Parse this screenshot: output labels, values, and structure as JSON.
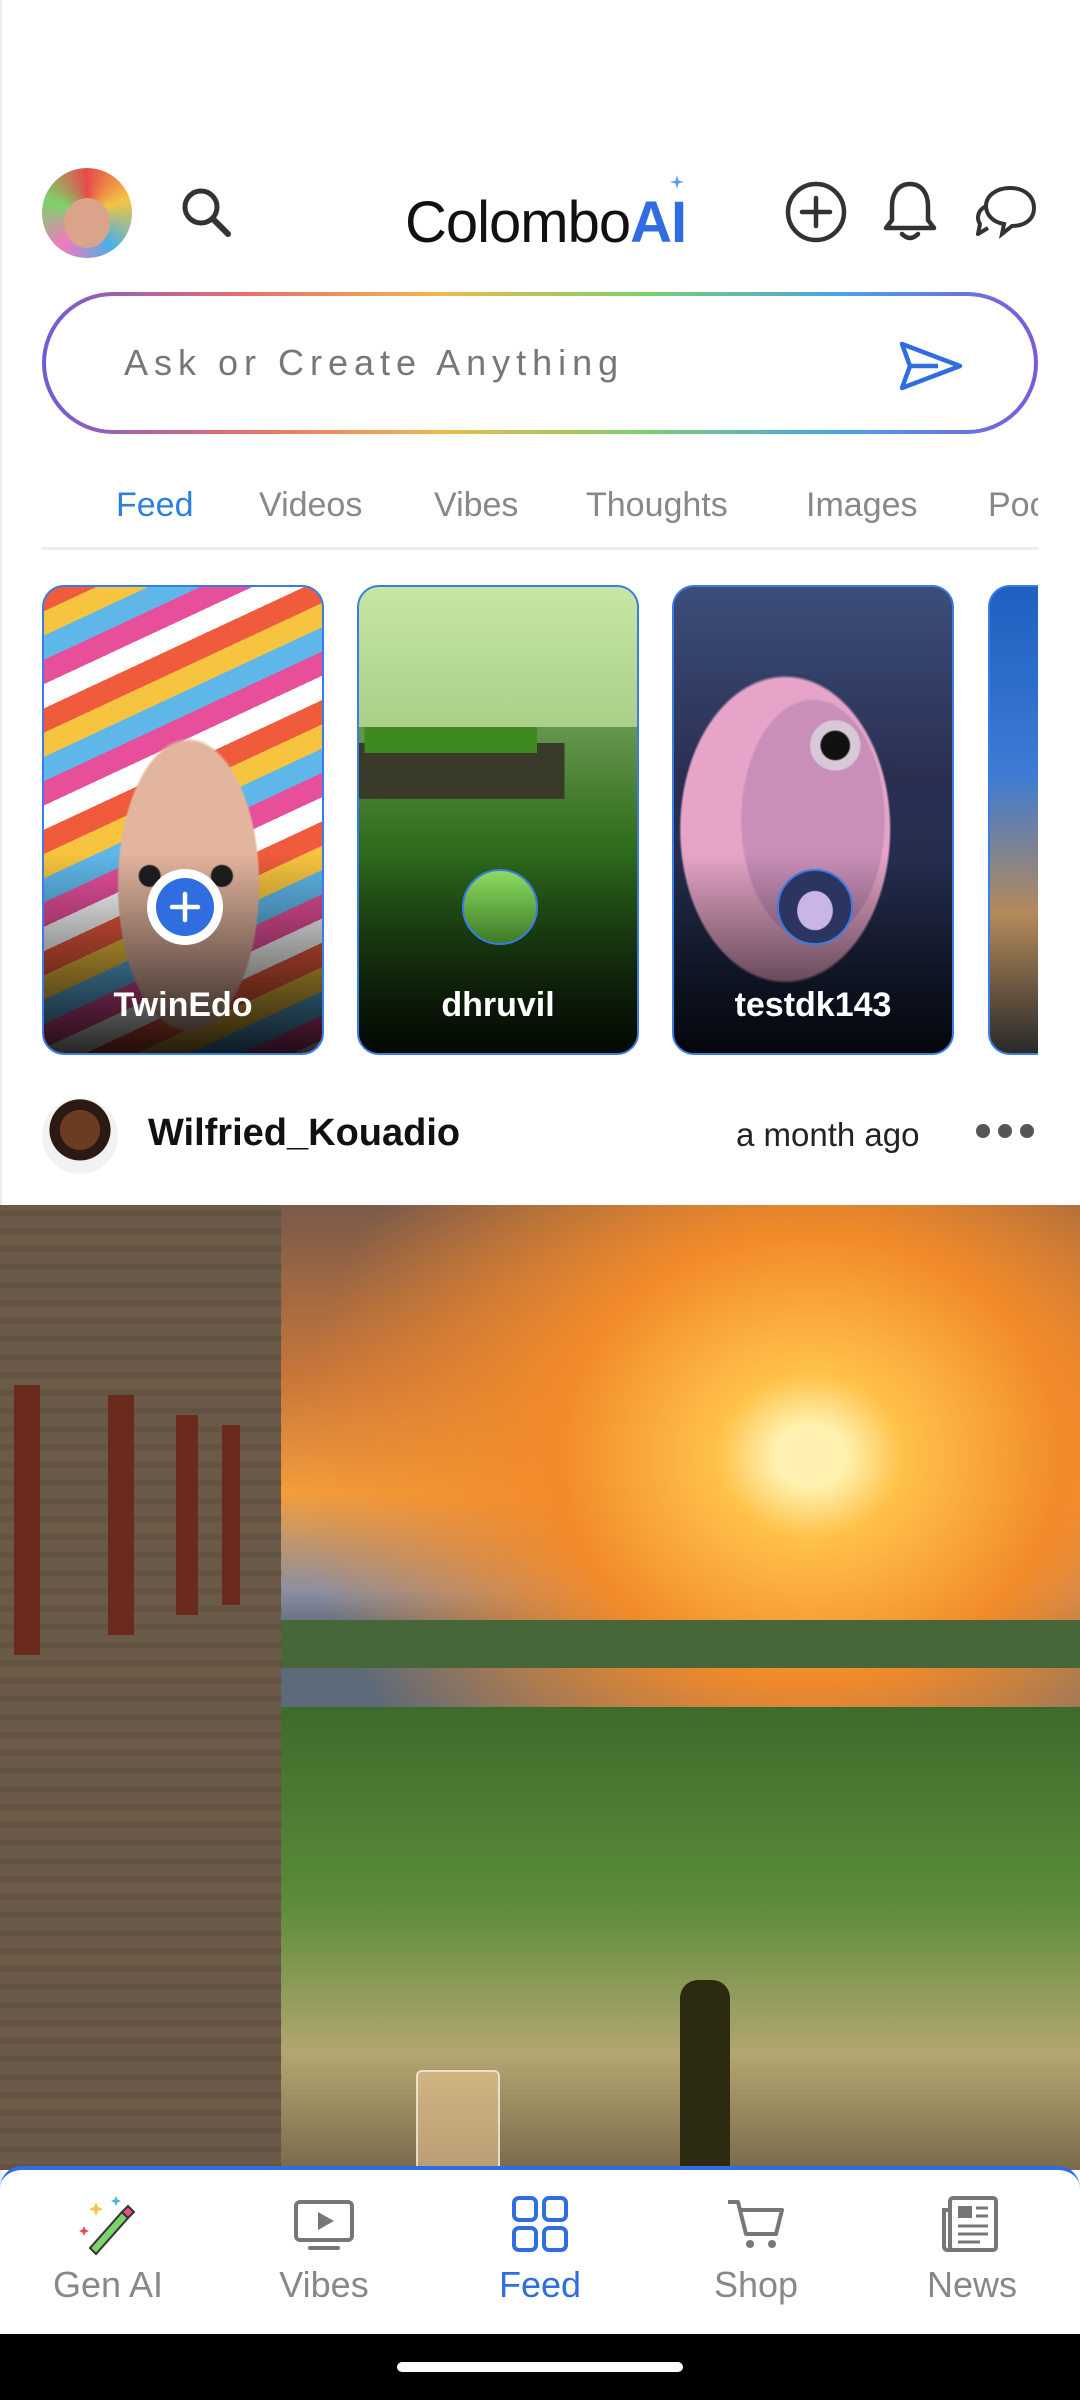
{
  "header": {
    "logo_text": "Colombo",
    "logo_accent": "AI",
    "brand_color": "#2f6de1"
  },
  "search": {
    "placeholder": "Ask or Create Anything"
  },
  "tabs": [
    {
      "label": "Feed",
      "active": true
    },
    {
      "label": "Videos",
      "active": false
    },
    {
      "label": "Vibes",
      "active": false
    },
    {
      "label": "Thoughts",
      "active": false
    },
    {
      "label": "Images",
      "active": false
    },
    {
      "label": "Poc",
      "active": false
    }
  ],
  "stories": [
    {
      "name": "TwinEdo"
    },
    {
      "name": "dhruvil"
    },
    {
      "name": "testdk143"
    }
  ],
  "post": {
    "username": "Wilfried_Kouadio",
    "time": "a month ago"
  },
  "bottom_nav": [
    {
      "label": "Gen AI",
      "icon": "magic-pen-icon",
      "active": false
    },
    {
      "label": "Vibes",
      "icon": "video-icon",
      "active": false
    },
    {
      "label": "Feed",
      "icon": "grid-icon",
      "active": true
    },
    {
      "label": "Shop",
      "icon": "cart-icon",
      "active": false
    },
    {
      "label": "News",
      "icon": "newspaper-icon",
      "active": false
    }
  ]
}
